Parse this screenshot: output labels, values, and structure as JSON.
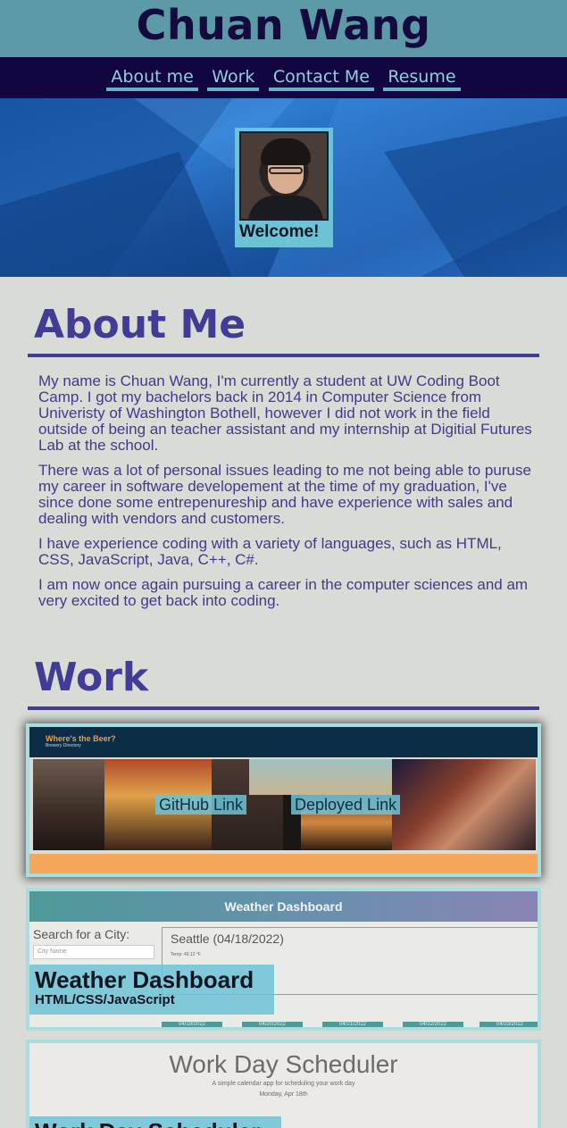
{
  "header": {
    "title": "Chuan Wang"
  },
  "nav": {
    "items": [
      "About me",
      "Work",
      "Contact Me",
      "Resume"
    ]
  },
  "hero": {
    "welcome": "Welcome!"
  },
  "about": {
    "title": "About Me",
    "paragraphs": [
      "My name is Chuan Wang, I'm currently a student at UW Coding Boot Camp. I got my bachelors back in 2014 in Computer Science from Univeristy of Washington Bothell, however I did not work in the field outside of being an teacher assistant and my internship at Digitial Futures Lab at the school.",
      "There was a lot of personal issues leading to me not being able to puruse my career in software developement at the time of my graduation, I've since done some entrepenureship and have experience with sales and dealing with vendors and customers.",
      "I have experience coding with a variety of languages, such as HTML, CSS, JavaScript, Java, C++, C#.",
      "I am now once again pursuing a career in the computer sciences and am very excited to get back into coding."
    ]
  },
  "work": {
    "title": "Work",
    "projects": [
      {
        "banner_title": "Where's the Beer?",
        "banner_subtitle": "Brewery Directory",
        "github_link": "GitHub Link",
        "deployed_link": "Deployed Link"
      },
      {
        "screenshot_title": "Weather Dashboard",
        "search_label": "Search for a City:",
        "search_placeholder": "City Name",
        "city_heading": "Seattle (04/18/2022)",
        "temp": "Temp: 49.12 °F",
        "forecast_dates": [
          "04/19/2022",
          "04/20/2022",
          "04/21/2022",
          "04/22/2022",
          "04/23/2022"
        ],
        "name": "Weather Dashboard",
        "tech": "HTML/CSS/JavaScript"
      },
      {
        "screenshot_title": "Work Day Scheduler",
        "screenshot_subtitle": "A simple calendar app for scheduling your work day",
        "screenshot_date": "Monday, Apr 18th",
        "name": "Work Day Scheduler"
      }
    ]
  },
  "colors": {
    "header_bg": "#5c9aa8",
    "nav_bg": "#130640",
    "accent": "#413d94",
    "card_accent": "#6cc3d6"
  }
}
